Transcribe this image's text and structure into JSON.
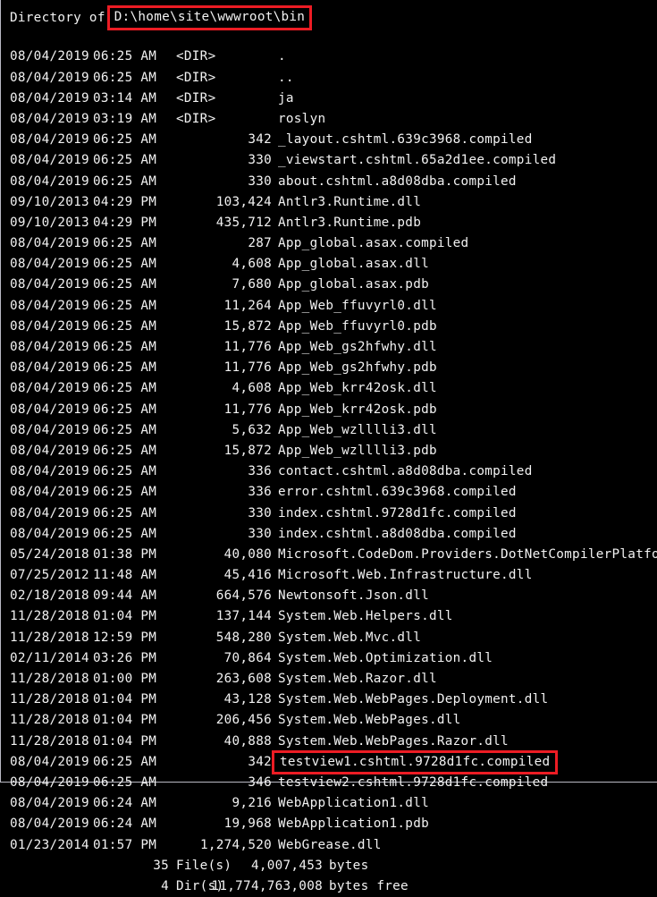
{
  "console": {
    "background_color": "#000000",
    "text_color": "#f2f2f2",
    "highlight_color": "#ec1c24",
    "header_prefix": "Directory of",
    "path": "D:\\home\\site\\wwwroot\\bin",
    "columns": [
      "date",
      "time",
      "size",
      "name"
    ],
    "dir_marker": "<DIR>",
    "entries": [
      {
        "date": "08/04/2019",
        "time": "06:25 AM",
        "size": "<DIR>",
        "is_dir": true,
        "name": "."
      },
      {
        "date": "08/04/2019",
        "time": "06:25 AM",
        "size": "<DIR>",
        "is_dir": true,
        "name": ".."
      },
      {
        "date": "08/04/2019",
        "time": "03:14 AM",
        "size": "<DIR>",
        "is_dir": true,
        "name": "ja"
      },
      {
        "date": "08/04/2019",
        "time": "03:19 AM",
        "size": "<DIR>",
        "is_dir": true,
        "name": "roslyn"
      },
      {
        "date": "08/04/2019",
        "time": "06:25 AM",
        "size": "342",
        "is_dir": false,
        "name": "_layout.cshtml.639c3968.compiled"
      },
      {
        "date": "08/04/2019",
        "time": "06:25 AM",
        "size": "330",
        "is_dir": false,
        "name": "_viewstart.cshtml.65a2d1ee.compiled"
      },
      {
        "date": "08/04/2019",
        "time": "06:25 AM",
        "size": "330",
        "is_dir": false,
        "name": "about.cshtml.a8d08dba.compiled"
      },
      {
        "date": "09/10/2013",
        "time": "04:29 PM",
        "size": "103,424",
        "is_dir": false,
        "name": "Antlr3.Runtime.dll"
      },
      {
        "date": "09/10/2013",
        "time": "04:29 PM",
        "size": "435,712",
        "is_dir": false,
        "name": "Antlr3.Runtime.pdb"
      },
      {
        "date": "08/04/2019",
        "time": "06:25 AM",
        "size": "287",
        "is_dir": false,
        "name": "App_global.asax.compiled"
      },
      {
        "date": "08/04/2019",
        "time": "06:25 AM",
        "size": "4,608",
        "is_dir": false,
        "name": "App_global.asax.dll"
      },
      {
        "date": "08/04/2019",
        "time": "06:25 AM",
        "size": "7,680",
        "is_dir": false,
        "name": "App_global.asax.pdb"
      },
      {
        "date": "08/04/2019",
        "time": "06:25 AM",
        "size": "11,264",
        "is_dir": false,
        "name": "App_Web_ffuvyrl0.dll"
      },
      {
        "date": "08/04/2019",
        "time": "06:25 AM",
        "size": "15,872",
        "is_dir": false,
        "name": "App_Web_ffuvyrl0.pdb"
      },
      {
        "date": "08/04/2019",
        "time": "06:25 AM",
        "size": "11,776",
        "is_dir": false,
        "name": "App_Web_gs2hfwhy.dll"
      },
      {
        "date": "08/04/2019",
        "time": "06:25 AM",
        "size": "11,776",
        "is_dir": false,
        "name": "App_Web_gs2hfwhy.pdb"
      },
      {
        "date": "08/04/2019",
        "time": "06:25 AM",
        "size": "4,608",
        "is_dir": false,
        "name": "App_Web_krr42osk.dll"
      },
      {
        "date": "08/04/2019",
        "time": "06:25 AM",
        "size": "11,776",
        "is_dir": false,
        "name": "App_Web_krr42osk.pdb"
      },
      {
        "date": "08/04/2019",
        "time": "06:25 AM",
        "size": "5,632",
        "is_dir": false,
        "name": "App_Web_wzlllli3.dll"
      },
      {
        "date": "08/04/2019",
        "time": "06:25 AM",
        "size": "15,872",
        "is_dir": false,
        "name": "App_Web_wzlllli3.pdb"
      },
      {
        "date": "08/04/2019",
        "time": "06:25 AM",
        "size": "336",
        "is_dir": false,
        "name": "contact.cshtml.a8d08dba.compiled"
      },
      {
        "date": "08/04/2019",
        "time": "06:25 AM",
        "size": "336",
        "is_dir": false,
        "name": "error.cshtml.639c3968.compiled"
      },
      {
        "date": "08/04/2019",
        "time": "06:25 AM",
        "size": "330",
        "is_dir": false,
        "name": "index.cshtml.9728d1fc.compiled"
      },
      {
        "date": "08/04/2019",
        "time": "06:25 AM",
        "size": "330",
        "is_dir": false,
        "name": "index.cshtml.a8d08dba.compiled"
      },
      {
        "date": "05/24/2018",
        "time": "01:38 PM",
        "size": "40,080",
        "is_dir": false,
        "name": "Microsoft.CodeDom.Providers.DotNetCompilerPlatform.dll"
      },
      {
        "date": "07/25/2012",
        "time": "11:48 AM",
        "size": "45,416",
        "is_dir": false,
        "name": "Microsoft.Web.Infrastructure.dll"
      },
      {
        "date": "02/18/2018",
        "time": "09:44 AM",
        "size": "664,576",
        "is_dir": false,
        "name": "Newtonsoft.Json.dll"
      },
      {
        "date": "11/28/2018",
        "time": "01:04 PM",
        "size": "137,144",
        "is_dir": false,
        "name": "System.Web.Helpers.dll"
      },
      {
        "date": "11/28/2018",
        "time": "12:59 PM",
        "size": "548,280",
        "is_dir": false,
        "name": "System.Web.Mvc.dll"
      },
      {
        "date": "02/11/2014",
        "time": "03:26 PM",
        "size": "70,864",
        "is_dir": false,
        "name": "System.Web.Optimization.dll"
      },
      {
        "date": "11/28/2018",
        "time": "01:00 PM",
        "size": "263,608",
        "is_dir": false,
        "name": "System.Web.Razor.dll"
      },
      {
        "date": "11/28/2018",
        "time": "01:04 PM",
        "size": "43,128",
        "is_dir": false,
        "name": "System.Web.WebPages.Deployment.dll"
      },
      {
        "date": "11/28/2018",
        "time": "01:04 PM",
        "size": "206,456",
        "is_dir": false,
        "name": "System.Web.WebPages.dll"
      },
      {
        "date": "11/28/2018",
        "time": "01:04 PM",
        "size": "40,888",
        "is_dir": false,
        "name": "System.Web.WebPages.Razor.dll"
      },
      {
        "date": "08/04/2019",
        "time": "06:25 AM",
        "size": "342",
        "is_dir": false,
        "name": "testview1.cshtml.9728d1fc.compiled",
        "highlighted": true
      },
      {
        "date": "08/04/2019",
        "time": "06:25 AM",
        "size": "346",
        "is_dir": false,
        "name": "testview2.cshtml.9728d1fc.compiled"
      },
      {
        "date": "08/04/2019",
        "time": "06:24 AM",
        "size": "9,216",
        "is_dir": false,
        "name": "WebApplication1.dll"
      },
      {
        "date": "08/04/2019",
        "time": "06:24 AM",
        "size": "19,968",
        "is_dir": false,
        "name": "WebApplication1.pdb"
      },
      {
        "date": "01/23/2014",
        "time": "01:57 PM",
        "size": "1,274,520",
        "is_dir": false,
        "name": "WebGrease.dll"
      }
    ],
    "summary": {
      "file_count": "35",
      "file_label": "File(s)",
      "total_bytes": "4,007,453",
      "bytes_unit": "bytes",
      "dir_count": "4",
      "dir_label": "Dir(s)",
      "free_bytes": "11,774,763,008",
      "free_unit": "bytes free"
    }
  }
}
